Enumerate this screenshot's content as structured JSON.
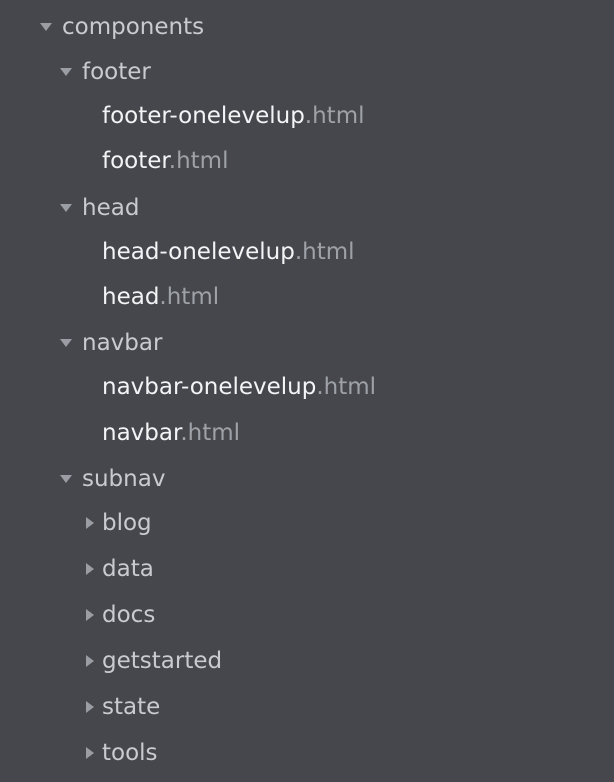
{
  "tree": {
    "root": {
      "label": "components",
      "children": {
        "footer": {
          "label": "footer",
          "files": [
            {
              "base": "footer-onelevelup",
              "ext": ".html"
            },
            {
              "base": "footer",
              "ext": ".html"
            }
          ]
        },
        "head": {
          "label": "head",
          "files": [
            {
              "base": "head-onelevelup",
              "ext": ".html"
            },
            {
              "base": "head",
              "ext": ".html"
            }
          ]
        },
        "navbar": {
          "label": "navbar",
          "files": [
            {
              "base": "navbar-onelevelup",
              "ext": ".html"
            },
            {
              "base": "navbar",
              "ext": ".html"
            }
          ]
        },
        "subnav": {
          "label": "subnav",
          "folders": [
            {
              "label": "blog"
            },
            {
              "label": "data"
            },
            {
              "label": "docs"
            },
            {
              "label": "getstarted"
            },
            {
              "label": "state"
            },
            {
              "label": "tools"
            }
          ]
        }
      }
    }
  },
  "colors": {
    "background": "#45474c",
    "folder_text": "#c9cbcf",
    "file_base_text": "#f3f4f6",
    "file_ext_text": "#9ea2a8",
    "arrow": "#9a9da3"
  },
  "icons": {
    "expanded": "caret-down-icon",
    "collapsed": "caret-right-icon"
  }
}
